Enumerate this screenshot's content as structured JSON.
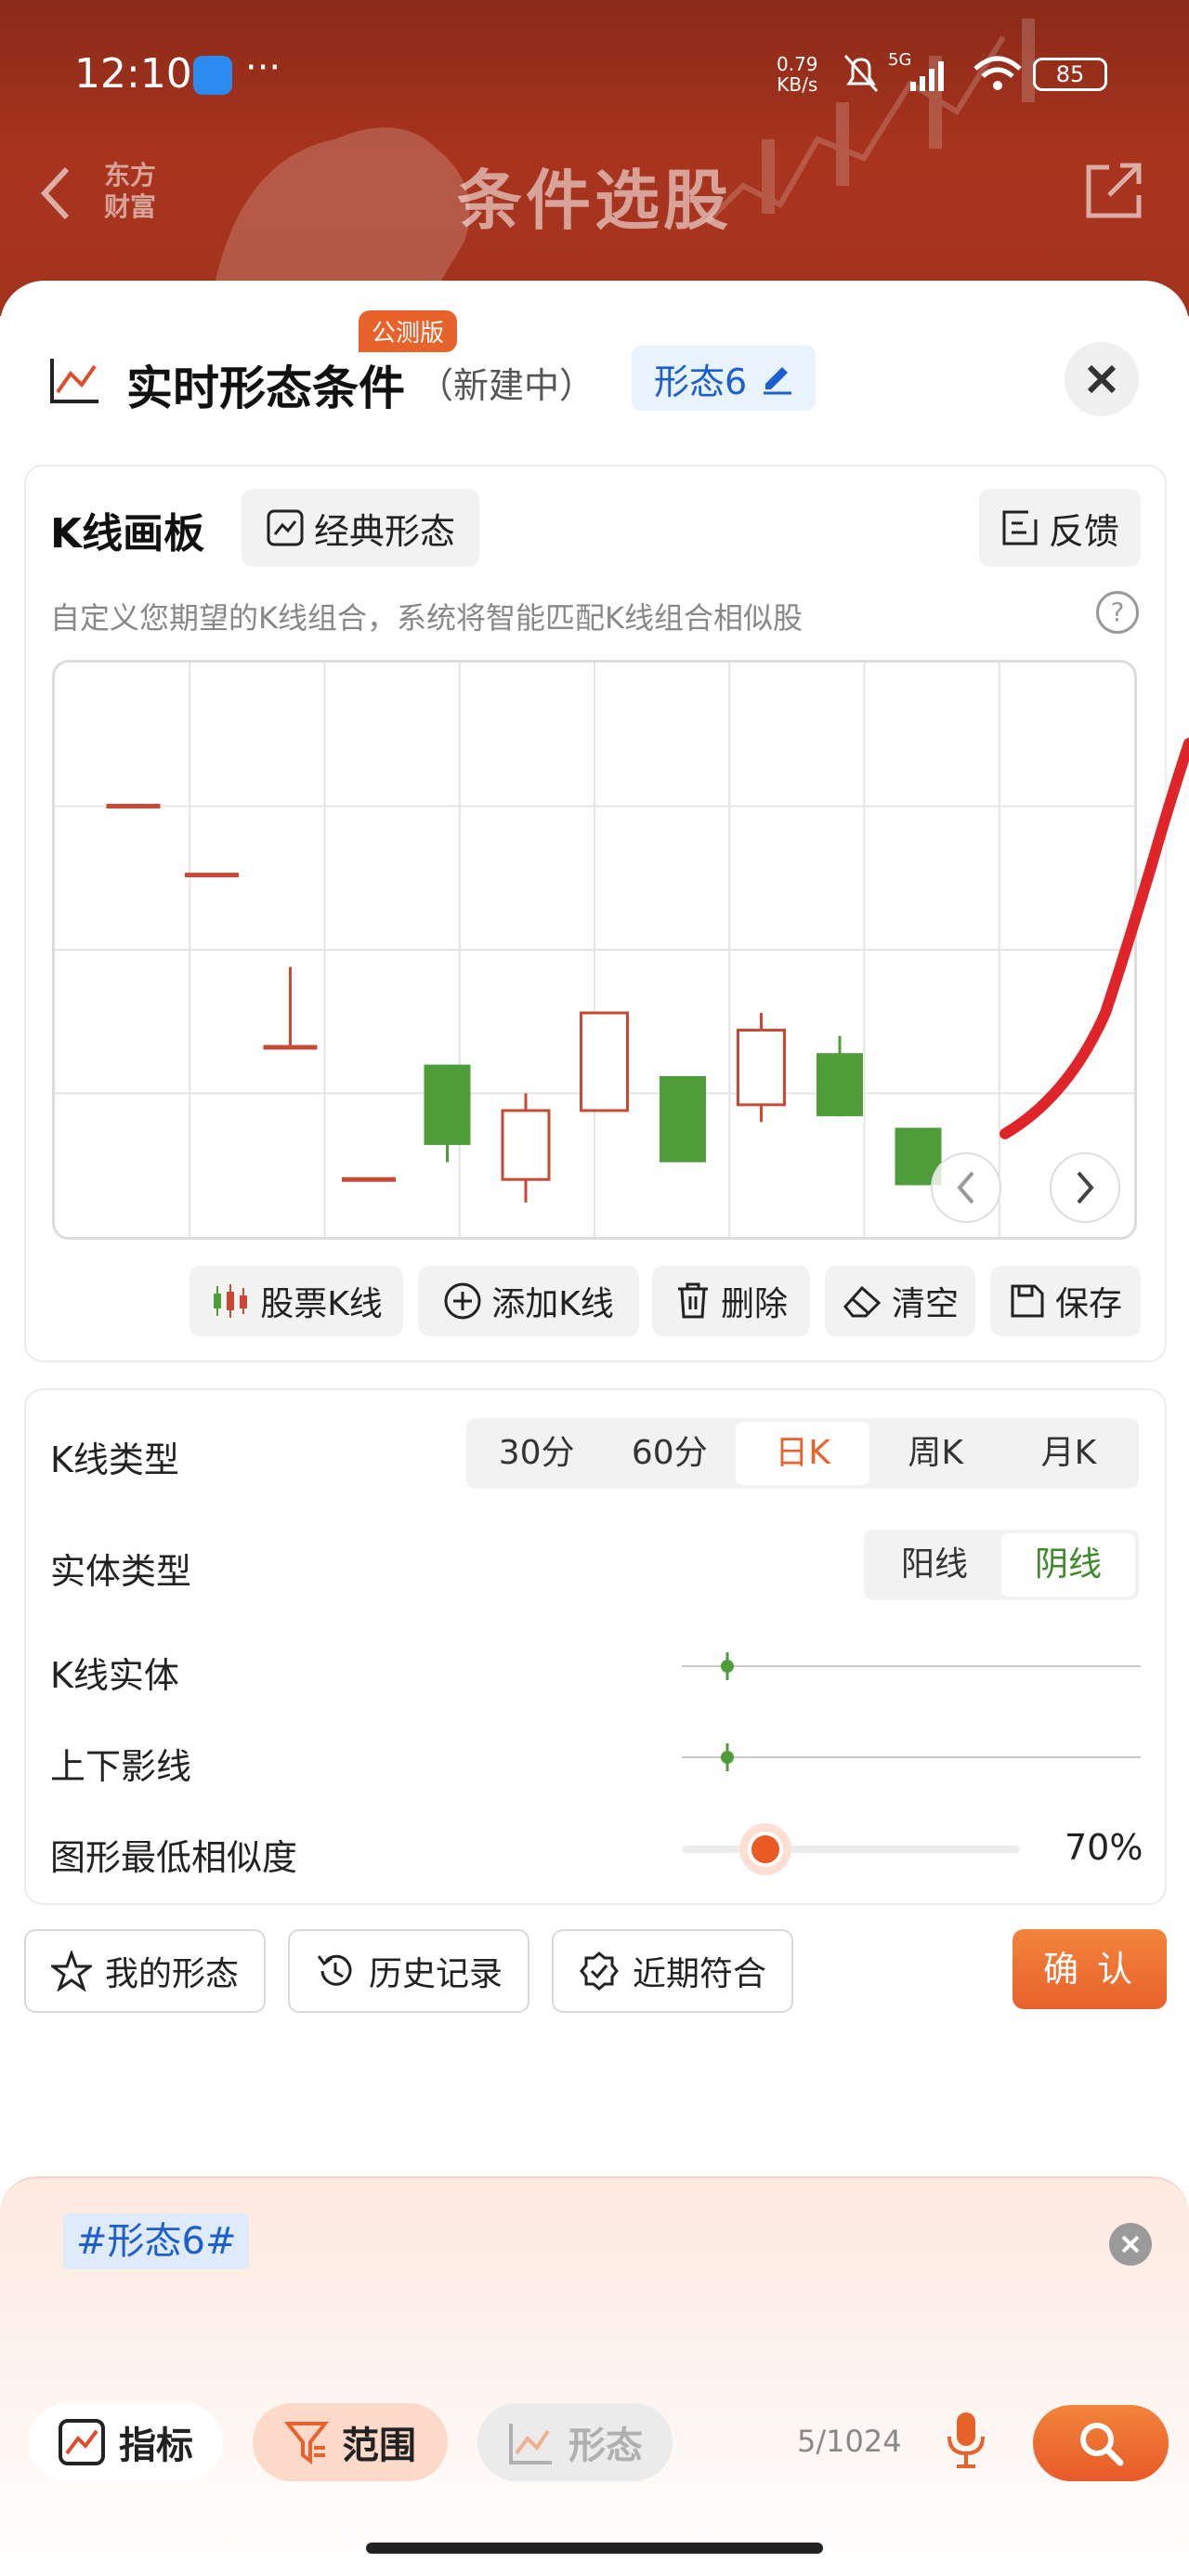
{
  "status_bar": {
    "time": "12:10",
    "more": "···",
    "net_speed_value": "0.79",
    "net_speed_unit": "KB/s",
    "signal": "5G",
    "battery": "85"
  },
  "header": {
    "title": "条件选股",
    "logo_line1": "东方",
    "logo_line2": "财富"
  },
  "panel": {
    "title": "实时形态条件",
    "status": "（新建中）",
    "beta_badge": "公测版",
    "pattern_name": "形态6"
  },
  "kboard": {
    "title": "K线画板",
    "classic_label": "经典形态",
    "feedback_label": "反馈",
    "hint": "自定义您期望的K线组合，系统将智能匹配K线组合相似股",
    "help": "?"
  },
  "chart_data": {
    "type": "candlestick",
    "candles": [
      {
        "index": 1,
        "color": "red",
        "open": 75,
        "close": 75,
        "high": 75,
        "low": 75
      },
      {
        "index": 2,
        "color": "red",
        "open": 63,
        "close": 63,
        "high": 63,
        "low": 63
      },
      {
        "index": 3,
        "color": "red",
        "open": 33,
        "close": 33,
        "high": 47,
        "low": 33
      },
      {
        "index": 4,
        "color": "red",
        "open": 10,
        "close": 10,
        "high": 10,
        "low": 10
      },
      {
        "index": 5,
        "color": "green",
        "open": 30,
        "close": 16,
        "high": 30,
        "low": 13
      },
      {
        "index": 6,
        "color": "red",
        "open": 10,
        "close": 22,
        "high": 25,
        "low": 6
      },
      {
        "index": 7,
        "color": "red",
        "open": 22,
        "close": 39,
        "high": 39,
        "low": 22
      },
      {
        "index": 8,
        "color": "green",
        "open": 28,
        "close": 13,
        "high": 28,
        "low": 13
      },
      {
        "index": 9,
        "color": "red",
        "open": 23,
        "close": 36,
        "high": 39,
        "low": 20
      },
      {
        "index": 10,
        "color": "green",
        "open": 32,
        "close": 21,
        "high": 35,
        "low": 21
      },
      {
        "index": 11,
        "color": "green",
        "open": 19,
        "close": 9,
        "high": 19,
        "low": 9
      }
    ],
    "grid": true
  },
  "toolbar": {
    "stock": "股票K线",
    "add": "添加K线",
    "delete": "删除",
    "clear": "清空",
    "save": "保存"
  },
  "settings": {
    "ktype_label": "K线类型",
    "ktype_options": [
      "30分",
      "60分",
      "日K",
      "周K",
      "月K"
    ],
    "ktype_selected": "日K",
    "body_type_label": "实体类型",
    "body_type_options": [
      "阳线",
      "阴线"
    ],
    "body_type_selected": "阴线",
    "body_label": "K线实体",
    "body_value": 0.1,
    "shadow_label": "上下影线",
    "shadow_value": 0.1,
    "similarity_label": "图形最低相似度",
    "similarity_value": "70%"
  },
  "actions": {
    "my_patterns": "我的形态",
    "history": "历史记录",
    "recent": "近期符合",
    "confirm": "确 认"
  },
  "query": {
    "tag": "#形态6#",
    "counter": "5/1024"
  },
  "bottom_tabs": {
    "indicator": "指标",
    "range": "范围",
    "pattern": "形态"
  },
  "colors": {
    "accent": "#e8622c",
    "up": "#c84a35",
    "down": "#4e9c3a",
    "brand_red": "#a3331d",
    "tag_blue": "#1d5fcf"
  }
}
